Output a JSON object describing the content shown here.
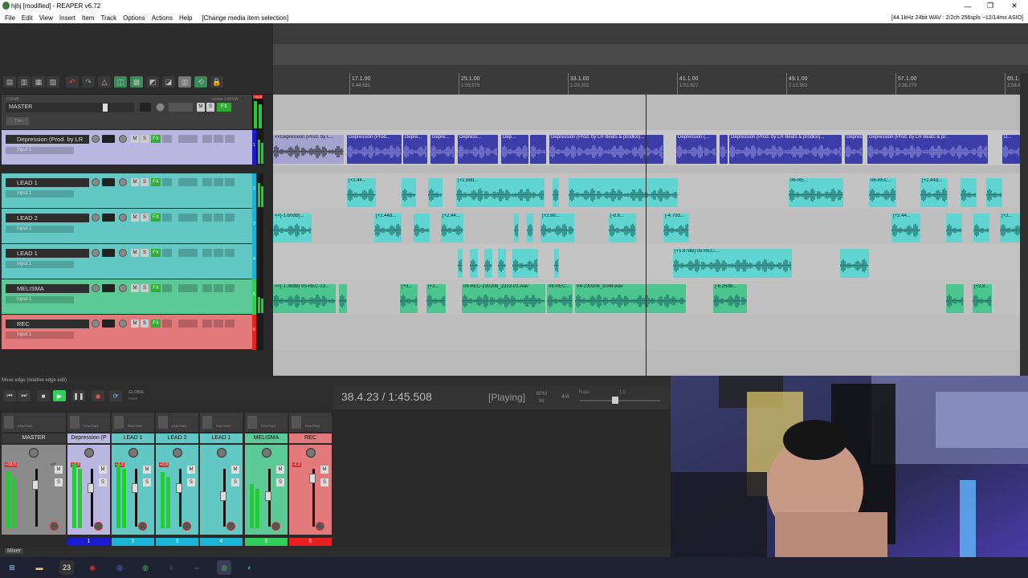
{
  "window": {
    "title": "hjhj [modified] - REAPER v6.72",
    "controls": [
      "—",
      "❐",
      "✕"
    ]
  },
  "menu": {
    "items": [
      "File",
      "Edit",
      "View",
      "Insert",
      "Item",
      "Track",
      "Options",
      "Actions",
      "Help"
    ],
    "action_status": "[Change media item selection]",
    "audio_status": "[44.1kHz 24bit WAV : 2/2ch 256spls ~12/14ms ASIO]"
  },
  "ruler": {
    "marks": [
      {
        "bar": "17.1.00",
        "time": "0:44.651"
      },
      {
        "bar": "25.1.00",
        "time": "1:06.976"
      },
      {
        "bar": "33.1.00",
        "time": "1:29.302"
      },
      {
        "bar": "41.1.00",
        "time": "1:51.627"
      },
      {
        "bar": "49.1.00",
        "time": "2:13.953"
      },
      {
        "bar": "57.1.00",
        "time": "2:36.279"
      },
      {
        "bar": "65.1.00",
        "time": "2:58.604"
      }
    ]
  },
  "master": {
    "name": "MASTER",
    "vol": "0.00dB",
    "pan": "center",
    "width": "100%W",
    "trim": "Trim",
    "peak": "+16.0"
  },
  "tracks": [
    {
      "num": "1",
      "name": "Depression (Prod. by LR",
      "input": "Input 1",
      "color": "#b9b6e0"
    },
    {
      "num": "2",
      "name": "LEAD 1",
      "input": "Input 1",
      "color": "#63c7c4"
    },
    {
      "num": "3",
      "name": "LEAD 2",
      "input": "Input 1",
      "color": "#63c7c4"
    },
    {
      "num": "4",
      "name": "LEAD 1",
      "input": "Input 1",
      "color": "#63c7c4"
    },
    {
      "num": "5",
      "name": "MELISMA",
      "input": "Input 1",
      "color": "#5dc996"
    },
    {
      "num": "6",
      "name": "REC",
      "input": "Input 1",
      "color": "#e2797b"
    }
  ],
  "item_labels": {
    "depression": [
      "<<Depression (Prod. by L...",
      "Depression (Prod...",
      "Depre...",
      "Depre...",
      "Depress...",
      "Dep...",
      "Depression (Prod. by LR Beats & prodkxi)...",
      "Depression (...",
      "Depression (Prod. by LR Beats & prodkxi)...",
      "Depress...",
      "Depression (Prod. by LR Beats & pr...",
      "D..."
    ],
    "lead1": [
      "[+2.44...",
      "[+2.88d...",
      "[+2.88dB...",
      "[+2.88d...",
      "06-RE...",
      "06-REC...",
      "[+2.44d..."
    ],
    "lead2": [
      "<<[-1.60dB]...",
      "[+2.44d...",
      "[+2.44...",
      "[+2.88...",
      "[-8.8...",
      "[-4.70d...",
      "[+2.44...",
      "[+2..."
    ],
    "lead1b": [
      "[+1.67dB]",
      "[+1.67dB] 05-REC-..."
    ],
    "melisma": [
      "<<[-1.36dB] 05-REC-23...",
      "[+3...",
      "[+3...",
      "06-REC-230206_2323-01.wav",
      "06-REC...",
      "04-230206_2048.wav",
      "[-6.25dB...",
      "[+3.8..."
    ]
  },
  "transport": {
    "hint": "Move edge (relative edge edit)",
    "time": "38.4.23 / 1:45.508",
    "state": "[Playing]",
    "bpm_label": "BPM",
    "bpm": "86",
    "sig": "4/4",
    "rate_label": "Rate:",
    "rate": "1.0",
    "global_label": "GLOBAL",
    "global_value": "none"
  },
  "mixer": {
    "label": "Mixer",
    "route_label": "ROUTING",
    "mono_label": "MONO",
    "strips": [
      {
        "name": "MASTER",
        "num": "",
        "color": "#8a8a8a",
        "peak": "+16.0",
        "vol": "-inf"
      },
      {
        "name": "Depression (P",
        "num": "1",
        "color": "#b9b6e0",
        "peak": "+4.3",
        "vol": ""
      },
      {
        "name": "LEAD 1",
        "num": "2",
        "color": "#63c7c4",
        "peak": "+1.6",
        "vol": ""
      },
      {
        "name": "LEAD 2",
        "num": "3",
        "color": "#63c7c4",
        "peak": "+2.0",
        "vol": ""
      },
      {
        "name": "LEAD 1",
        "num": "4",
        "color": "#63c7c4",
        "peak": "",
        "vol": ""
      },
      {
        "name": "MELISMA",
        "num": "5",
        "color": "#5dc996",
        "peak": "",
        "vol": ""
      },
      {
        "name": "REC",
        "num": "6",
        "color": "#e2797b",
        "peak": "-2.2",
        "vol": ""
      }
    ],
    "num_colors": [
      "#2a2a2a",
      "#1a1ad0",
      "#19b4d6",
      "#19b4d6",
      "#19b4d6",
      "#2fcf5a",
      "#e82020"
    ]
  },
  "taskbar": {
    "calendar_day": "23"
  }
}
